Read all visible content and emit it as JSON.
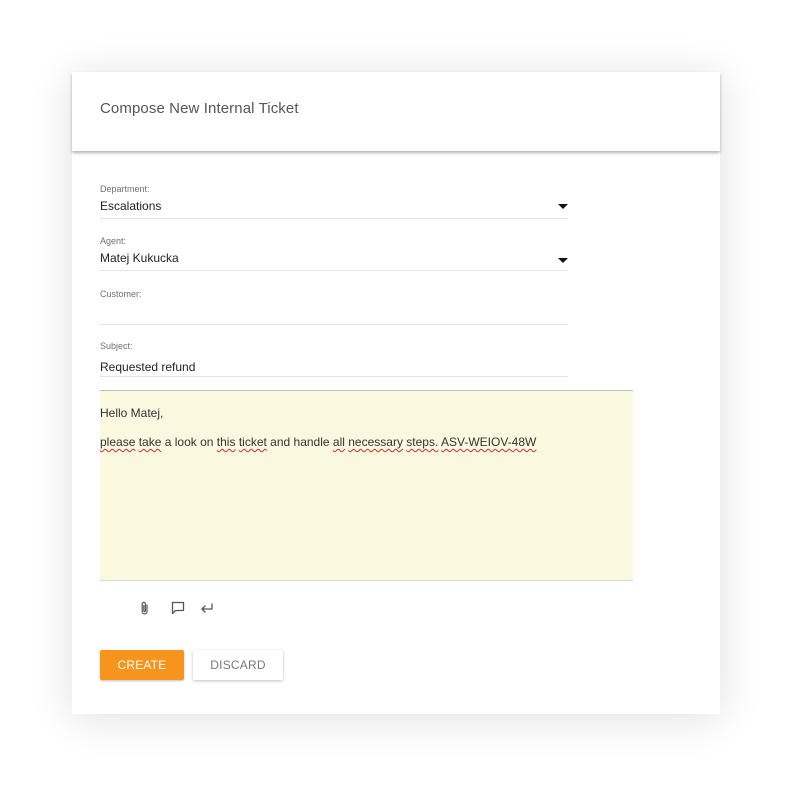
{
  "card": {
    "title": "Compose New Internal Ticket"
  },
  "form": {
    "department": {
      "label": "Department:",
      "value": "Escalations"
    },
    "agent": {
      "label": "Agent:",
      "value": "Matej Kukucka"
    },
    "customer": {
      "label": "Customer:",
      "value": ""
    },
    "subject": {
      "label": "Subject:",
      "value": "Requested refund"
    }
  },
  "editor": {
    "greeting": "Hello Matej,",
    "body": {
      "w1": "please",
      "s1": " ",
      "w2": "take",
      "s2": " a look on ",
      "w3": "this",
      "s3": " ",
      "w4": "ticket",
      "s4": " and handle ",
      "w5": "all",
      "s5": " ",
      "w6": "necessary",
      "s6": " ",
      "w7": "steps.",
      "s7": " ",
      "w8": "ASV-WEIOV-48W"
    }
  },
  "toolbar": {
    "icons": [
      "paperclip-icon",
      "comment-icon",
      "reply-icon"
    ]
  },
  "actions": {
    "create_label": "CREATE",
    "discard_label": "DISCARD"
  },
  "colors": {
    "accent": "#f7941d",
    "editor_background": "#faf8df",
    "spellcheck_underline": "#d32f2f"
  }
}
